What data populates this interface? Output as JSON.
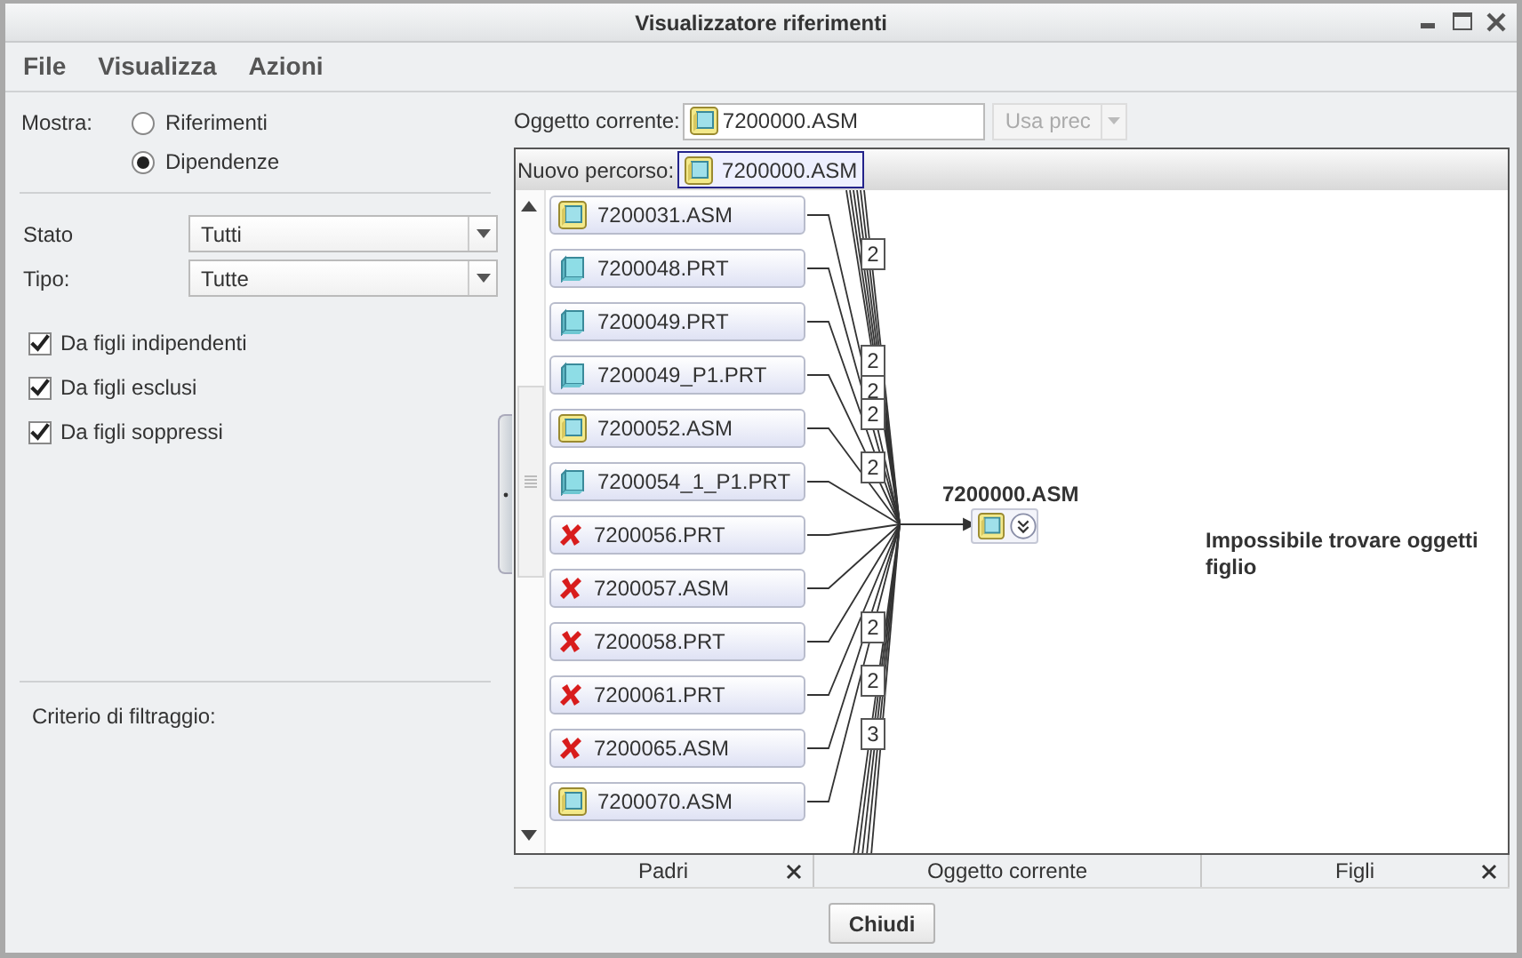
{
  "window": {
    "title": "Visualizzatore riferimenti"
  },
  "menu": [
    "File",
    "Visualizza",
    "Azioni"
  ],
  "filters": {
    "show_label": "Mostra:",
    "show_options": [
      {
        "label": "Riferimenti",
        "selected": false
      },
      {
        "label": "Dipendenze",
        "selected": true
      }
    ],
    "selects": [
      {
        "label": "Stato",
        "value": "Tutti"
      },
      {
        "label": "Tipo:",
        "value": "Tutte"
      }
    ],
    "checkboxes": [
      {
        "label": "Da figli indipendenti",
        "checked": true
      },
      {
        "label": "Da figli esclusi",
        "checked": true
      },
      {
        "label": "Da figli soppressi",
        "checked": true
      }
    ],
    "criteria_label": "Criterio di filtraggio:"
  },
  "current_object": {
    "label": "Oggetto corrente:",
    "value": "7200000.ASM",
    "kind": "asm"
  },
  "previous_button": {
    "label": "Usa prec",
    "disabled": true
  },
  "path": {
    "label": "Nuovo percorso:",
    "items": [
      {
        "label": "7200000.ASM",
        "kind": "asm",
        "selected": true
      }
    ]
  },
  "parents": [
    {
      "name": "7200031.ASM",
      "kind": "asm"
    },
    {
      "name": "7200048.PRT",
      "kind": "prt",
      "counts": [
        "2"
      ]
    },
    {
      "name": "7200049.PRT",
      "kind": "prt"
    },
    {
      "name": "7200049_P1.PRT",
      "kind": "prt",
      "counts": [
        "2",
        "2"
      ]
    },
    {
      "name": "7200052.ASM",
      "kind": "asm",
      "counts": [
        "2"
      ]
    },
    {
      "name": "7200054_1_P1.PRT",
      "kind": "prt",
      "counts": [
        "2"
      ]
    },
    {
      "name": "7200056.PRT",
      "kind": "missing"
    },
    {
      "name": "7200057.ASM",
      "kind": "missing"
    },
    {
      "name": "7200058.PRT",
      "kind": "missing",
      "counts": [
        "2"
      ]
    },
    {
      "name": "7200061.PRT",
      "kind": "missing",
      "counts": [
        "2"
      ]
    },
    {
      "name": "7200065.ASM",
      "kind": "missing",
      "counts": [
        "3"
      ]
    },
    {
      "name": "7200070.ASM",
      "kind": "asm"
    }
  ],
  "center": {
    "title": "7200000.ASM",
    "kind": "asm"
  },
  "children_message": "Impossibile trovare oggetti figlio",
  "panes": [
    {
      "label": "Padri",
      "closable": true
    },
    {
      "label": "Oggetto corrente",
      "closable": false
    },
    {
      "label": "Figli",
      "closable": true
    }
  ],
  "close_button": "Chiudi"
}
